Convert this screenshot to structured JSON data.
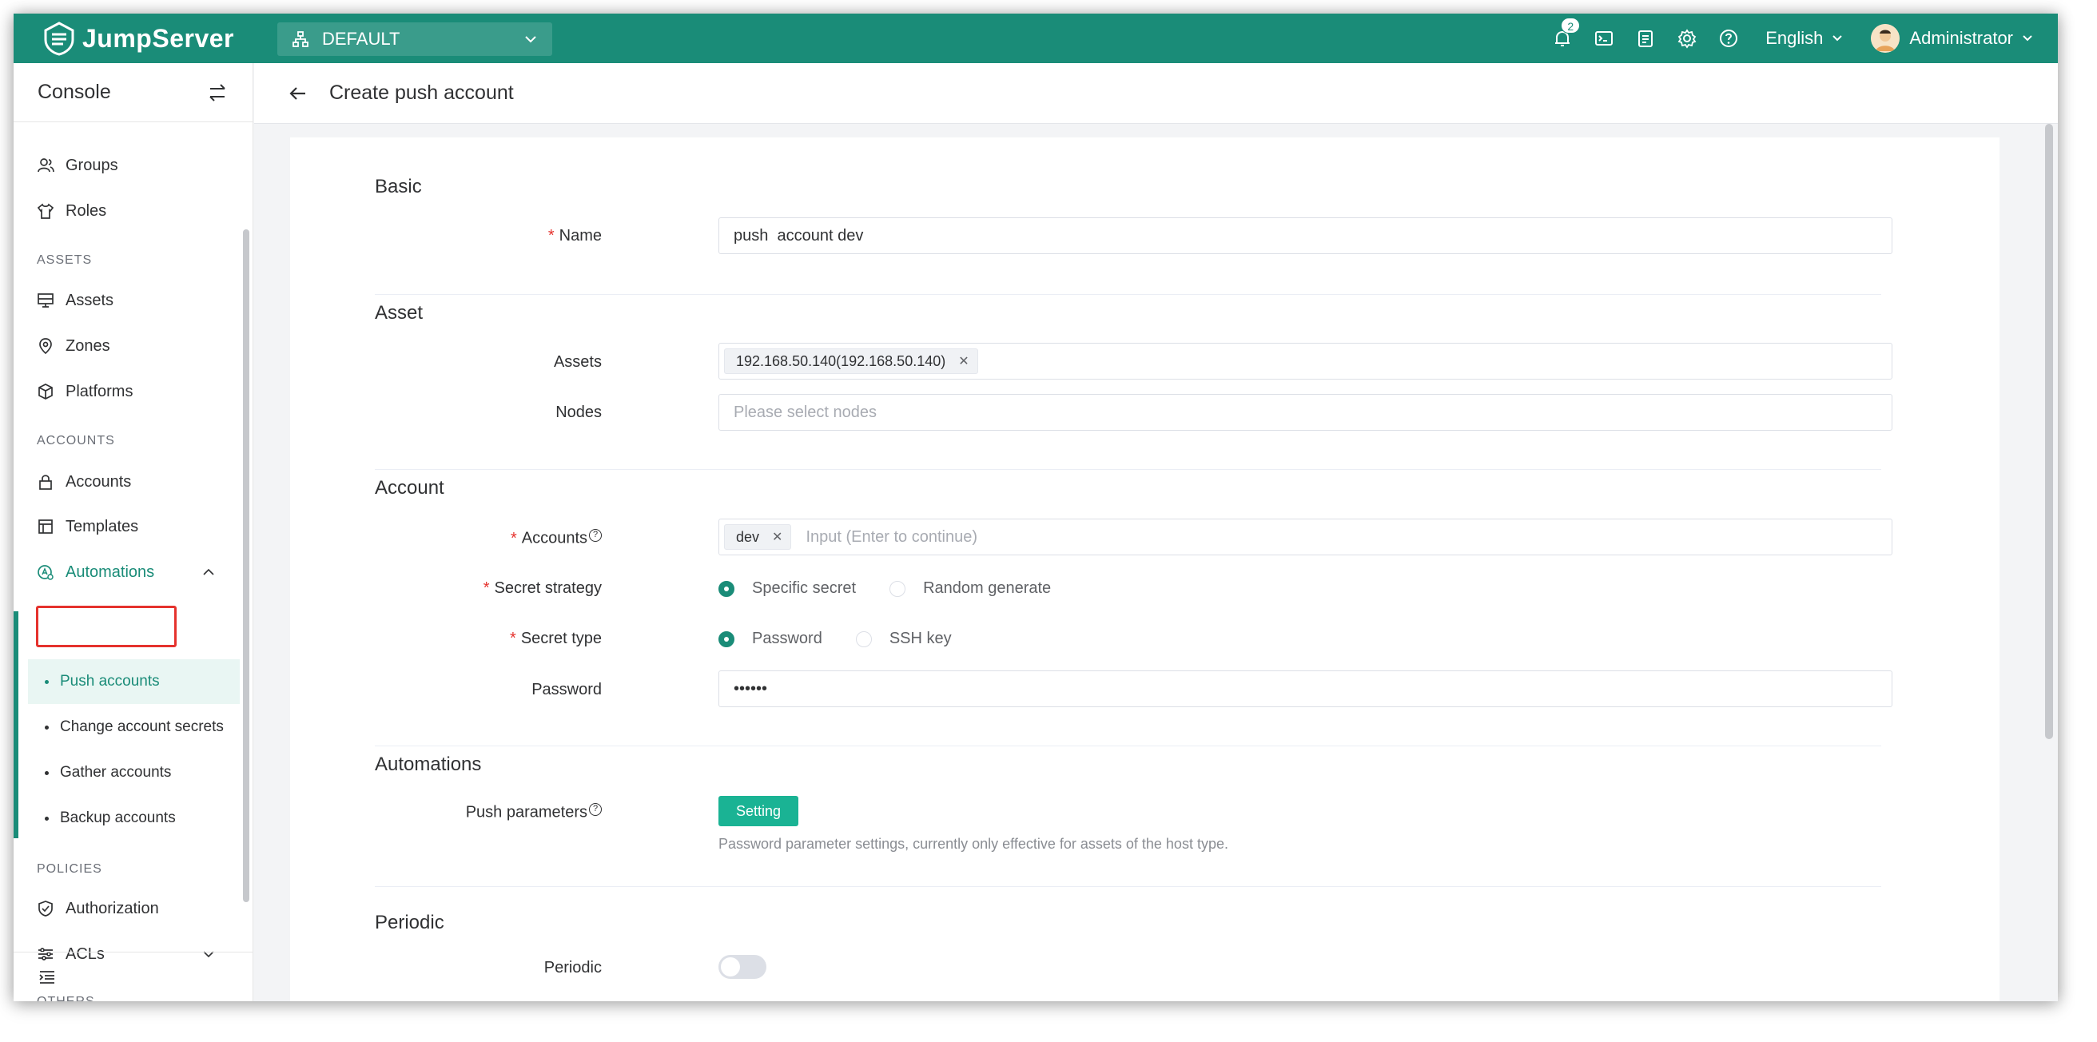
{
  "app": {
    "name": "JumpServer"
  },
  "header": {
    "org": "DEFAULT",
    "notification_count": "2",
    "language": "English",
    "user": "Administrator"
  },
  "sidebar": {
    "title": "Console",
    "items": {
      "groups": "Groups",
      "roles": "Roles",
      "assets_section": "ASSETS",
      "assets": "Assets",
      "zones": "Zones",
      "platforms": "Platforms",
      "accounts_section": "ACCOUNTS",
      "accounts": "Accounts",
      "templates": "Templates",
      "automations": "Automations",
      "push_accounts": "Push accounts",
      "change_secrets": "Change account secrets",
      "gather_accounts": "Gather accounts",
      "backup_accounts": "Backup accounts",
      "policies_section": "POLICIES",
      "authorization": "Authorization",
      "acls": "ACLs",
      "others_section": "OTHERS"
    }
  },
  "page": {
    "title": "Create push account"
  },
  "form": {
    "basic": {
      "title": "Basic",
      "name_label": "Name",
      "name_value": "push  account dev"
    },
    "asset": {
      "title": "Asset",
      "assets_label": "Assets",
      "asset_tag": "192.168.50.140(192.168.50.140)",
      "nodes_label": "Nodes",
      "nodes_placeholder": "Please select nodes"
    },
    "account": {
      "title": "Account",
      "accounts_label": "Accounts",
      "account_tag": "dev",
      "accounts_placeholder": "Input (Enter to continue)",
      "strategy_label": "Secret strategy",
      "strategy_opt1": "Specific secret",
      "strategy_opt2": "Random generate",
      "type_label": "Secret type",
      "type_opt1": "Password",
      "type_opt2": "SSH key",
      "password_label": "Password",
      "password_value": "••••••"
    },
    "automations": {
      "title": "Automations",
      "params_label": "Push parameters",
      "setting_button": "Setting",
      "help": "Password parameter settings, currently only effective for assets of the host type."
    },
    "periodic": {
      "title": "Periodic",
      "periodic_label": "Periodic"
    }
  },
  "colors": {
    "brand": "#1a8c78",
    "required": "#e5322d",
    "button": "#1ab394"
  }
}
